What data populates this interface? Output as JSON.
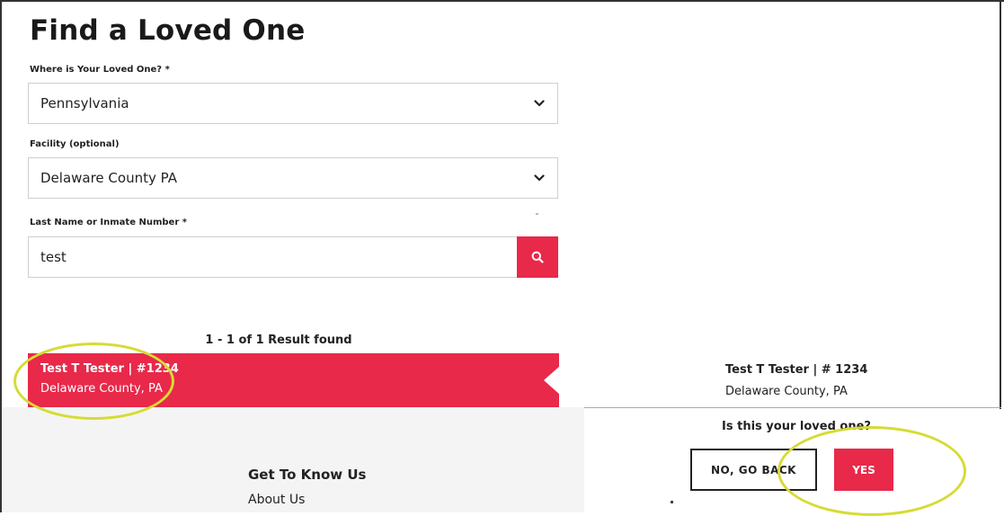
{
  "page": {
    "title": "Find a Loved One"
  },
  "form": {
    "location_label": "Where is Your Loved One? *",
    "location_value": "Pennsylvania",
    "facility_label": "Facility (optional)",
    "facility_value": "Delaware County PA",
    "search_label": "Last Name or Inmate Number *",
    "search_value": "test"
  },
  "results": {
    "count_text": "1 - 1 of 1 Result found",
    "items": [
      {
        "name": "Test T Tester | #1234",
        "location": "Delaware County, PA"
      }
    ]
  },
  "confirm": {
    "name": "Test T Tester | # 1234",
    "location": "Delaware County, PA",
    "question": "Is this your loved one?",
    "back_label": "NO, GO BACK",
    "yes_label": "YES"
  },
  "footer": {
    "heading": "Get To Know Us",
    "link": "About Us"
  },
  "icons": {
    "dropdown": "chevron-down-icon",
    "search": "search-icon"
  },
  "colors": {
    "accent": "#e8294a",
    "highlight": "#d5dc33"
  }
}
